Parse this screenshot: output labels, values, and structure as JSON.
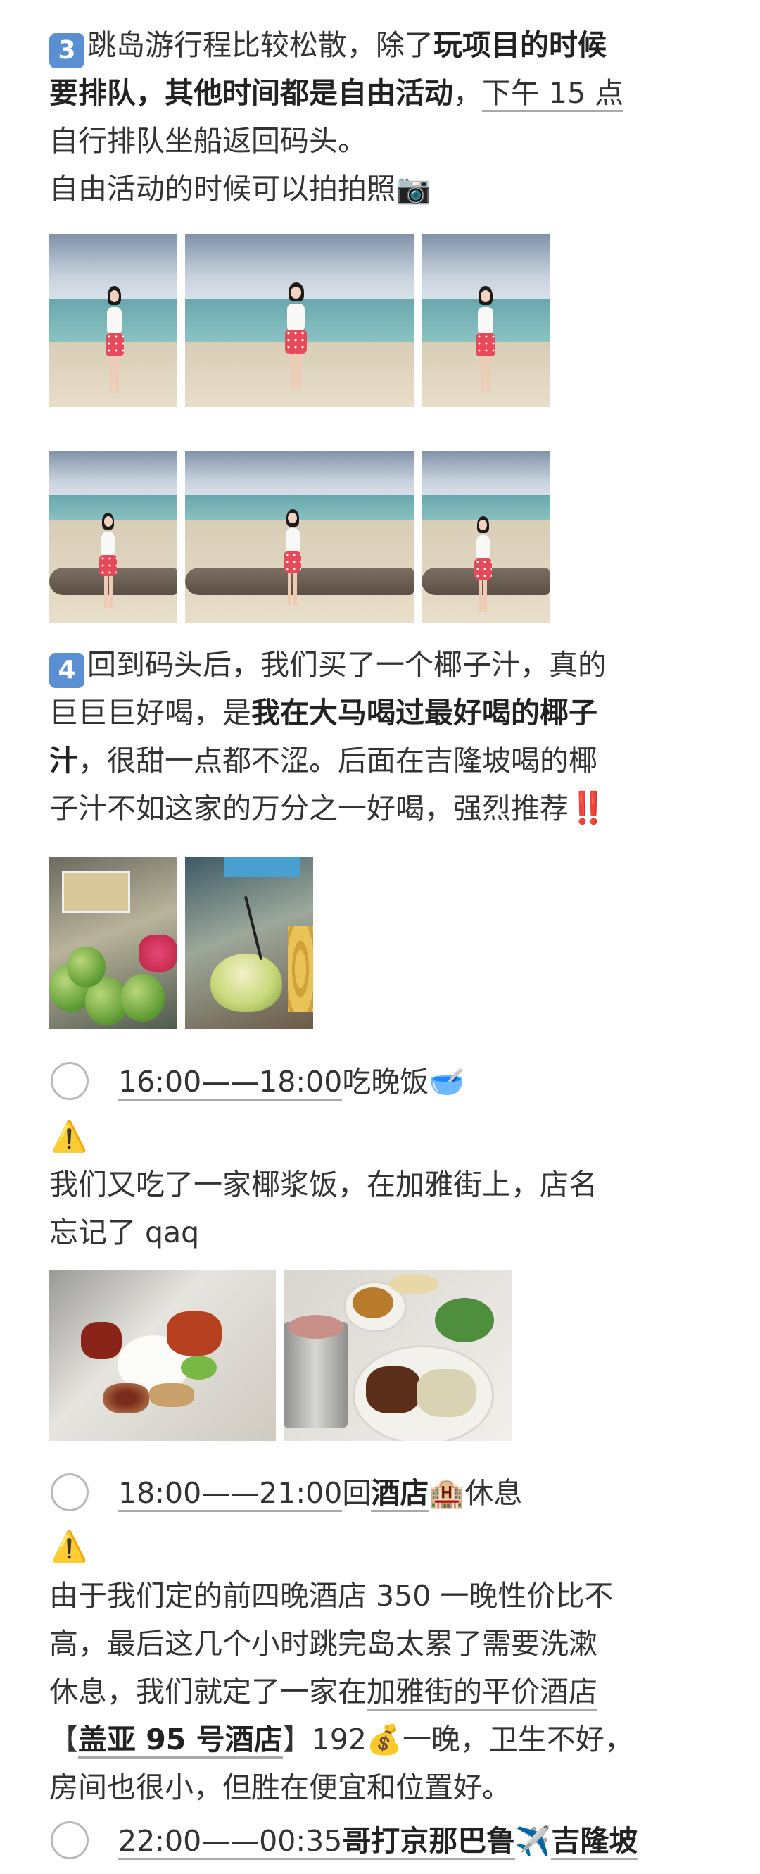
{
  "section3": {
    "badge": "3",
    "t1": "跳岛游行程比较松散，除了",
    "t1_bold": "玩项目的时候",
    "t2_bold": "要排队，其他时间都是自由活动",
    "t2_sep": "，",
    "t2_underline": "下午 15 点",
    "t3": "自行排队坐船返回码头。",
    "t4": "自由活动的时候可以拍拍照",
    "camera_emoji": "📷"
  },
  "section4": {
    "badge": "4",
    "l1": "回到码头后，我们买了一个椰子汁，真的",
    "l2_a": "巨巨巨好喝，是",
    "l2_bold": "我在大马喝过最好喝的椰子",
    "l3_bold": "汁",
    "l3_b": "，很甜一点都不涩。后面在吉隆坡喝的椰",
    "l4": "子汁不如这家的万分之一好喝，强烈推荐",
    "exclaim": "‼️"
  },
  "item_dinner": {
    "time_start": "16:00",
    "dash": "——",
    "time_end": "18:00",
    "label": "吃晚饭",
    "emoji": "🥣",
    "warn_icon": "⚠️",
    "line1": "我们又吃了一家椰浆饭，在加雅街上，店名",
    "line2": "忘记了 qaq"
  },
  "item_hotel": {
    "time_start": "18:00",
    "dash": "——",
    "time_end": "21:00",
    "label_a": "回",
    "label_bold": "酒店",
    "emoji": "🏨",
    "label_b": "休息",
    "warn_icon": "⚠️",
    "line1": "由于我们定的前四晚酒店 350 一晚性价比不",
    "line2": "高，最后这几个小时跳完岛太累了需要洗漱",
    "line3_a": "休息，我们就定了一家在",
    "line3_u": "加雅街的平价酒店",
    "line4_a": "【",
    "line4_bold": "盖亚 95 号酒店",
    "line4_b": "】192",
    "money_emoji": "💰",
    "line4_c": "一晚，卫生不好，",
    "line5": "房间也很小，但胜在便宜和位置好。"
  },
  "item_flight": {
    "time_start": "22:00",
    "dash": "——",
    "time_end": "00:35",
    "from_bold": "哥打京那巴鲁",
    "plane_emoji": "✈️",
    "to_bold": "吉隆坡"
  }
}
